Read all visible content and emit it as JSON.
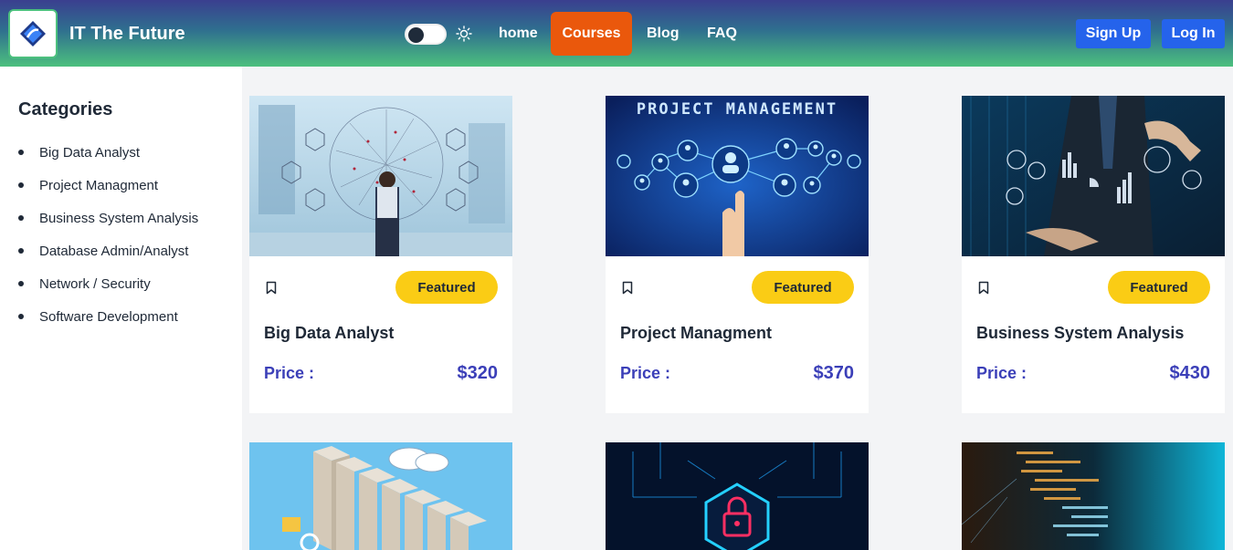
{
  "header": {
    "brand": "IT The Future",
    "nav": {
      "home": "home",
      "courses": "Courses",
      "blog": "Blog",
      "faq": "FAQ"
    },
    "sign_up": "Sign Up",
    "log_in": "Log In",
    "theme_toggle": "dark-mode-off"
  },
  "sidebar": {
    "title": "Categories",
    "items": [
      "Big Data Analyst",
      "Project Managment",
      "Business System Analysis",
      "Database Admin/Analyst",
      "Network / Security",
      "Software Development"
    ]
  },
  "courses": [
    {
      "title": "Big Data Analyst",
      "badge": "Featured",
      "price_label": "Price :",
      "price": "$320"
    },
    {
      "title": "Project Managment",
      "badge": "Featured",
      "price_label": "Price :",
      "price": "$370",
      "image_text": "PROJECT MANAGEMENT"
    },
    {
      "title": "Business System Analysis",
      "badge": "Featured",
      "price_label": "Price :",
      "price": "$430"
    }
  ],
  "colors": {
    "courses_active": "#ea580c",
    "button_blue": "#2563eb",
    "badge_yellow": "#facc15",
    "price_color": "#3b3fb8"
  }
}
